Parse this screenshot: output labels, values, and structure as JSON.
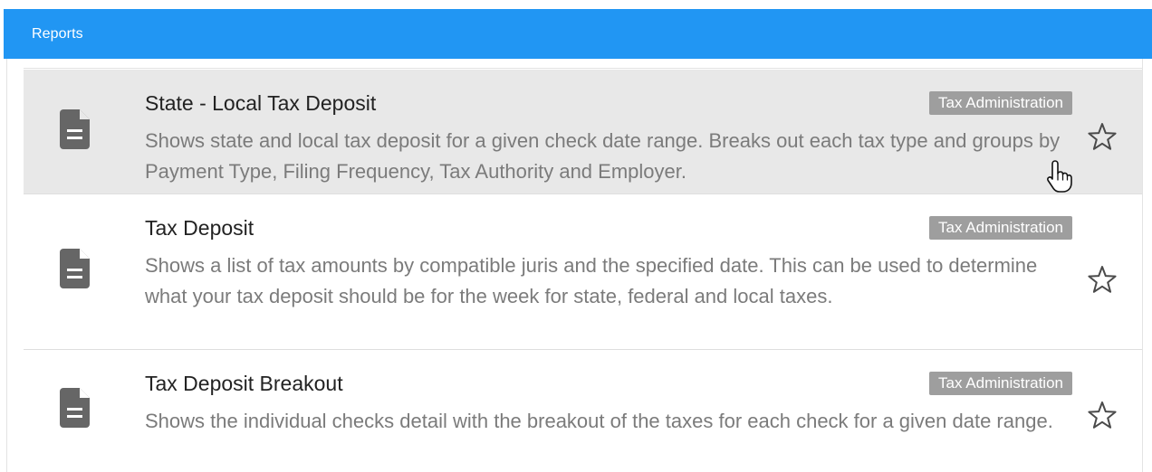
{
  "header": {
    "title": "Reports"
  },
  "reports": [
    {
      "title": "State - Local Tax Deposit",
      "description": "Shows state and local tax deposit for a given check date range. Breaks out each tax type and groups by Payment Type, Filing Frequency, Tax Authority and Employer.",
      "category": "Tax Administration",
      "favorite": false
    },
    {
      "title": "Tax Deposit",
      "description": "Shows a list of tax amounts by compatible juris and the specified date. This can be used to determine what your tax deposit should be for the week for state, federal and local taxes.",
      "category": "Tax Administration",
      "favorite": false
    },
    {
      "title": "Tax Deposit Breakout",
      "description": "Shows the individual checks detail with the breakout of the taxes for each check for a given date range.",
      "category": "Tax Administration",
      "favorite": false
    }
  ],
  "icons": {
    "report": "document-icon",
    "favorite": "star-outline-icon",
    "cursor": "hand-pointer-icon"
  },
  "colors": {
    "header_bg": "#2196f3",
    "hover_row_bg": "#e8e8e8",
    "tag_bg": "#9e9e9e",
    "icon": "#666666"
  }
}
